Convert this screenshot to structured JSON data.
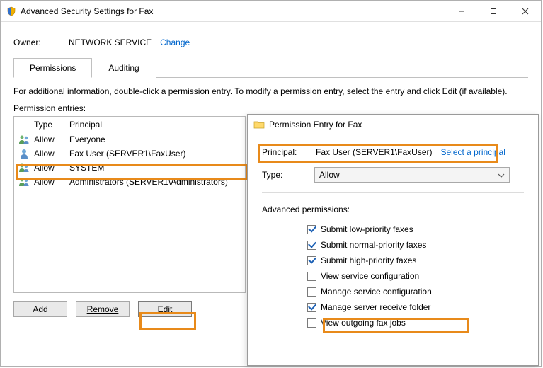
{
  "window": {
    "title": "Advanced Security Settings for Fax",
    "owner_label": "Owner:",
    "owner_value": "NETWORK SERVICE",
    "change_link": "Change"
  },
  "tabs": {
    "permissions": "Permissions",
    "auditing": "Auditing"
  },
  "description": "For additional information, double-click a permission entry. To modify a permission entry, select the entry and click Edit (if available).",
  "entries_label": "Permission entries:",
  "headers": {
    "type": "Type",
    "principal": "Principal"
  },
  "rows": [
    {
      "type": "Allow",
      "principal": "Everyone"
    },
    {
      "type": "Allow",
      "principal": "Fax User (SERVER1\\FaxUser)"
    },
    {
      "type": "Allow",
      "principal": "SYSTEM"
    },
    {
      "type": "Allow",
      "principal": "Administrators (SERVER1\\Administrators)"
    }
  ],
  "buttons": {
    "add": "Add",
    "remove": "Remove",
    "edit": "Edit"
  },
  "overlay": {
    "title": "Permission Entry for Fax",
    "principal_label": "Principal:",
    "principal_value": "Fax User (SERVER1\\FaxUser)",
    "select_principal": "Select a principal",
    "type_label": "Type:",
    "type_value": "Allow",
    "perm_head": "Advanced permissions:",
    "perms": [
      {
        "label": "Submit low-priority faxes",
        "checked": true
      },
      {
        "label": "Submit normal-priority faxes",
        "checked": true
      },
      {
        "label": "Submit high-priority faxes",
        "checked": true
      },
      {
        "label": "View service configuration",
        "checked": false
      },
      {
        "label": "Manage service configuration",
        "checked": false
      },
      {
        "label": "Manage server receive folder",
        "checked": true
      },
      {
        "label": "View outgoing fax jobs",
        "checked": false
      }
    ]
  }
}
